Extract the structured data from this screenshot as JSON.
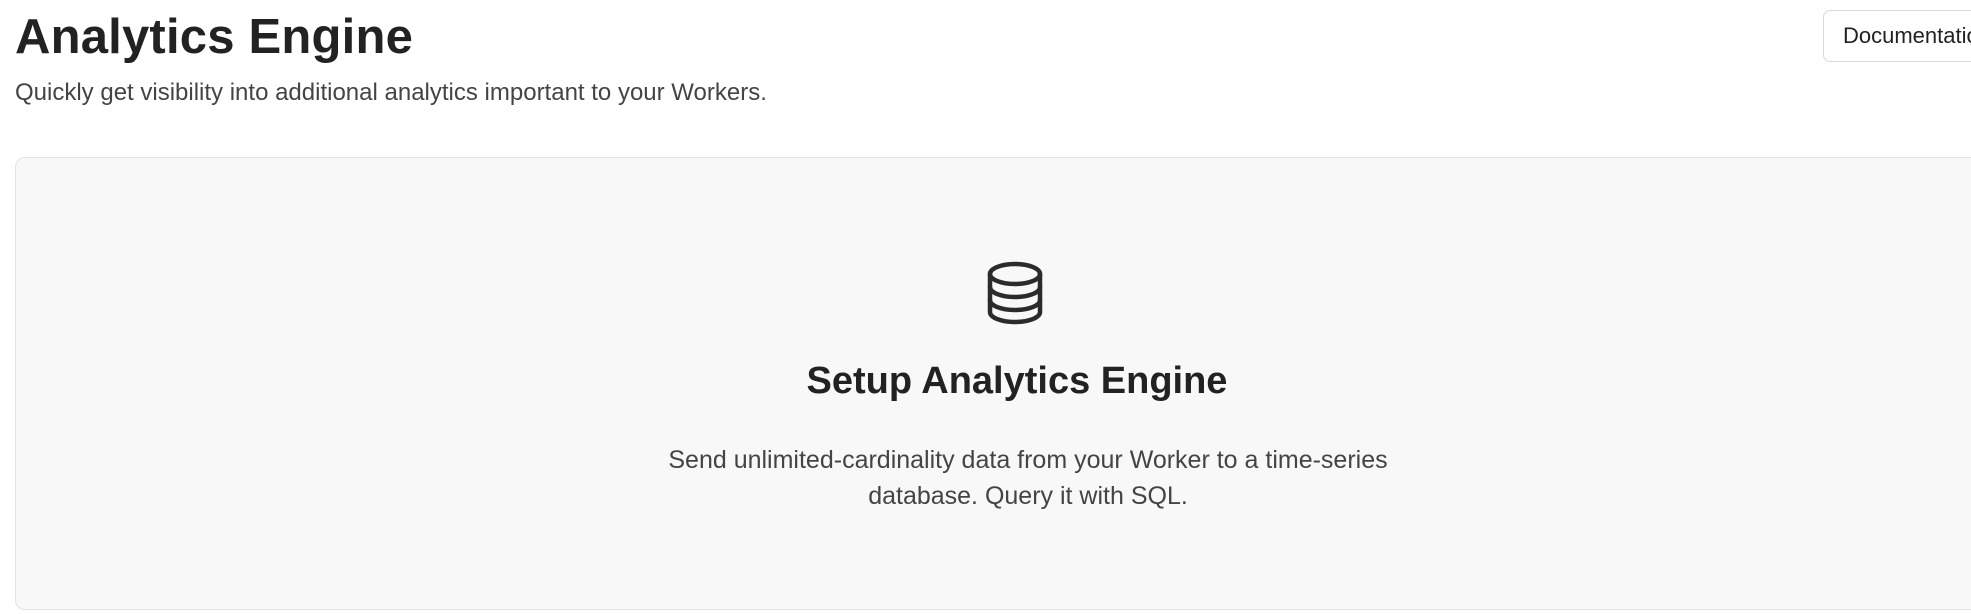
{
  "header": {
    "title": "Analytics Engine",
    "subtitle": "Quickly get visibility into additional analytics important to your Workers."
  },
  "toolbar": {
    "documentation_label": "Documentation"
  },
  "empty_state": {
    "icon": "database-icon",
    "title": "Setup Analytics Engine",
    "description": "Send unlimited-cardinality data from your Worker to a time-series database. Query it with SQL."
  },
  "colors": {
    "text_primary": "#222222",
    "text_secondary": "#444444",
    "card_background": "#f8f8f8",
    "card_border": "#e3e3e3"
  }
}
